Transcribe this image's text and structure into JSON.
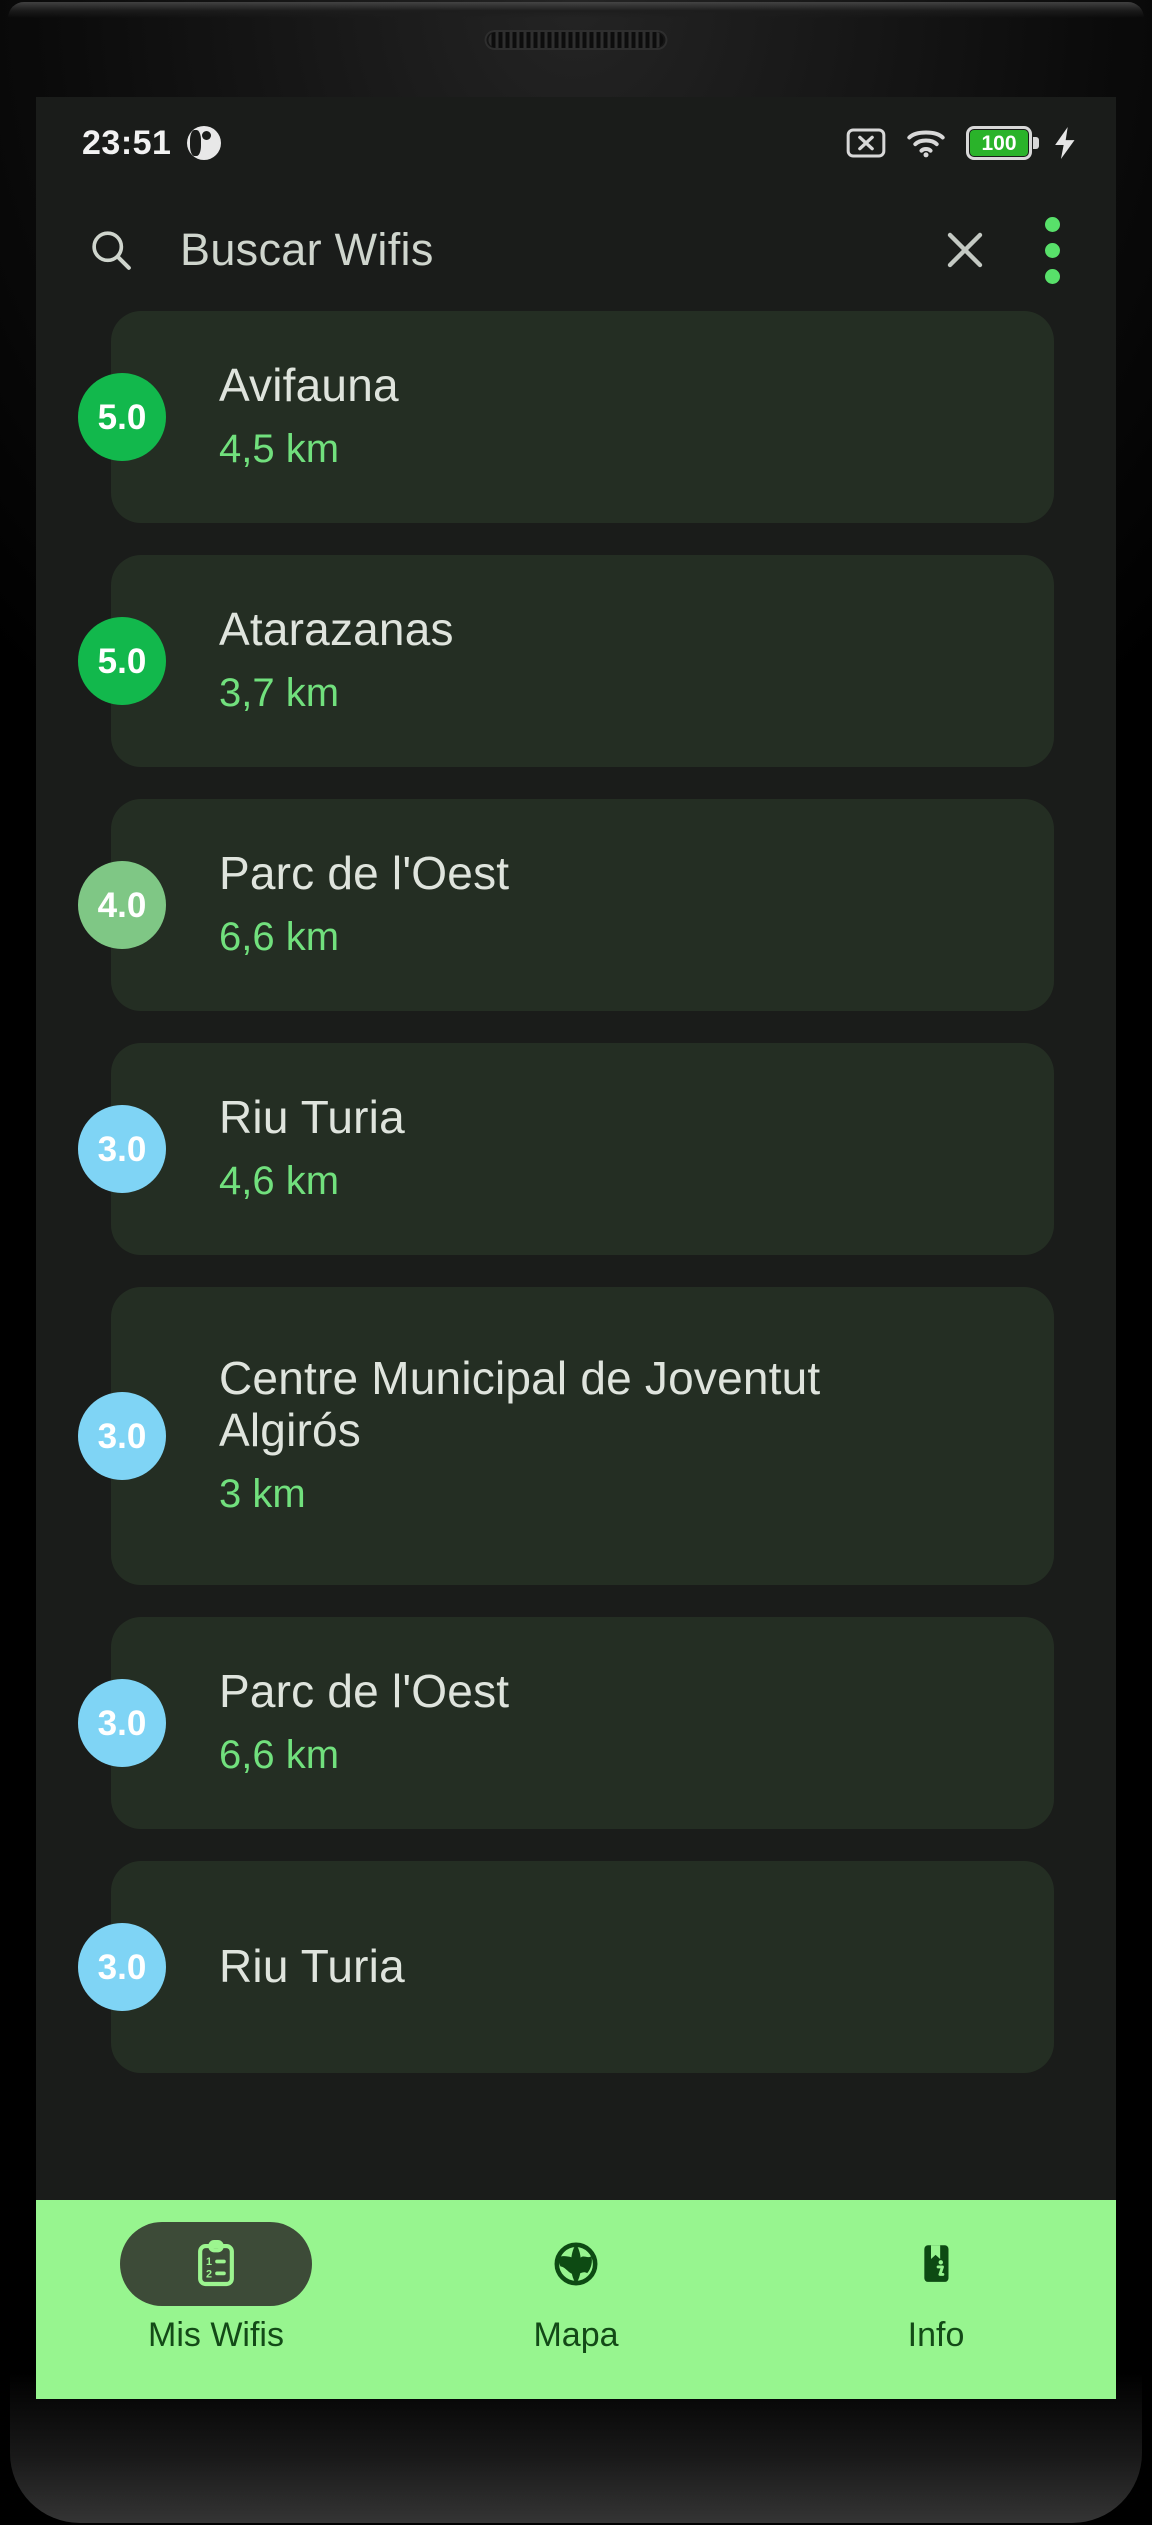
{
  "status_bar": {
    "time": "23:51",
    "dnd_icon": "do-not-disturb-icon",
    "sim_icon": "sim-card-x-icon",
    "wifi_icon": "wifi-icon",
    "battery_level": "100",
    "charging_icon": "lightning-bolt-icon",
    "battery_color": "#2ab32a"
  },
  "app_bar": {
    "search_icon": "search-icon",
    "title": "Buscar Wifis",
    "close_icon": "close-icon",
    "overflow_icon": "more-vertical-icon",
    "overflow_color": "#58e06a"
  },
  "colors": {
    "screen_bg": "#1a1c1a",
    "card_bg": "#242e23",
    "distance_green": "#71e07d",
    "rating_5": "#12b84c",
    "rating_4": "#7fc785",
    "rating_3": "#7fd4f5",
    "nav_bg": "#97f58f",
    "nav_pill": "#3d4b38",
    "nav_text": "#134a17"
  },
  "wifi_list": [
    {
      "rating": "5.0",
      "name": "Avifauna",
      "distance": "4,5 km",
      "badge_color": "#12b84c",
      "two_line": false
    },
    {
      "rating": "5.0",
      "name": "Atarazanas",
      "distance": "3,7 km",
      "badge_color": "#12b84c",
      "two_line": false
    },
    {
      "rating": "4.0",
      "name": "Parc de l'Oest",
      "distance": "6,6 km",
      "badge_color": "#7fc785",
      "two_line": false
    },
    {
      "rating": "3.0",
      "name": "Riu Turia",
      "distance": "4,6 km",
      "badge_color": "#7fd4f5",
      "two_line": false
    },
    {
      "rating": "3.0",
      "name": "Centre Municipal de Joventut Algirós",
      "distance": "3 km",
      "badge_color": "#7fd4f5",
      "two_line": true
    },
    {
      "rating": "3.0",
      "name": "Parc de l'Oest",
      "distance": "6,6 km",
      "badge_color": "#7fd4f5",
      "two_line": false
    },
    {
      "rating": "3.0",
      "name": "Riu Turia",
      "distance": "",
      "badge_color": "#7fd4f5",
      "two_line": false
    }
  ],
  "bottom_nav": [
    {
      "label": "Mis Wifis",
      "icon": "clipboard-list-icon",
      "active": true
    },
    {
      "label": "Mapa",
      "icon": "globe-icon",
      "active": false
    },
    {
      "label": "Info",
      "icon": "book-info-icon",
      "active": false
    }
  ]
}
